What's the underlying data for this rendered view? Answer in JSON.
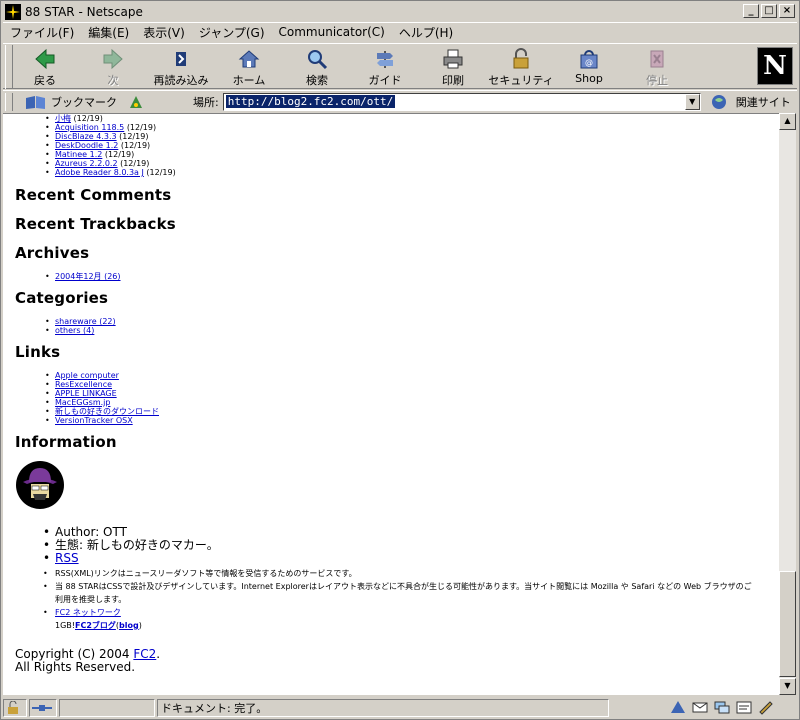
{
  "window": {
    "title": "88 STAR - Netscape"
  },
  "menu": [
    "ファイル(F)",
    "編集(E)",
    "表示(V)",
    "ジャンプ(G)",
    "Communicator(C)",
    "ヘルプ(H)"
  ],
  "toolbar": {
    "back": "戻る",
    "forward": "次",
    "reload": "再読み込み",
    "home": "ホーム",
    "search": "検索",
    "guide": "ガイド",
    "print": "印刷",
    "security": "セキュリティ",
    "shop": "Shop",
    "stop": "停止",
    "logo": "N"
  },
  "location": {
    "bookmarks_label": "ブックマーク",
    "location_label": "場所:",
    "url": "http://blog2.fc2.com/ott/",
    "related_label": "関連サイト"
  },
  "page": {
    "recent_entries": [
      {
        "title": "小梅",
        "date": "(12/19)"
      },
      {
        "title": "Acquisition 118.5",
        "date": "(12/19)"
      },
      {
        "title": "DiscBlaze 4.3.3",
        "date": "(12/19)"
      },
      {
        "title": "DeskDoodle 1.2",
        "date": "(12/19)"
      },
      {
        "title": "Matinee 1.2",
        "date": "(12/19)"
      },
      {
        "title": "Azureus 2.2.0.2",
        "date": "(12/19)"
      },
      {
        "title": "Adobe Reader 8.0.3a J",
        "date": "(12/19)"
      }
    ],
    "recent_comments_heading": "Recent Comments",
    "recent_trackbacks_heading": "Recent Trackbacks",
    "archives_heading": "Archives",
    "archives": [
      "2004年12月 (26)"
    ],
    "categories_heading": "Categories",
    "categories": [
      "shareware (22)",
      "others (4)"
    ],
    "links_heading": "Links",
    "links": [
      "Apple computer",
      "ResExcellence",
      "APPLE LINKAGE",
      "MacEGGsm.jp",
      "新しもの好きのダウンロード",
      "VersionTracker OSX"
    ],
    "information_heading": "Information",
    "info": {
      "author": "Author: OTT",
      "about": "生態: 新しもの好きのマカー。",
      "rss_link": "RSS",
      "rss_desc": "RSS(XML)リンクはニュースリーダソフト等で情報を受信するためのサービスです。",
      "css_note_1": "当 88 STARはCSSで設計及びデザインしています。Internet Explorerはレイアウト表示などに不具合が生じる可能性があります。当サイト閲覧には Mozilla や Safari などの Web ブラウザのご",
      "css_note_2": "利用を推奨します。",
      "fc2_network": "FC2 ネットワーク",
      "fc2_sub_prefix": "1GB!",
      "fc2_blog": "FC2ブログ",
      "fc2_blog_paren_open": "(",
      "fc2_blog_en": "blog",
      "fc2_blog_paren_close": ")"
    },
    "copyright_prefix": "Copyright (C) 2004 ",
    "copyright_link": "FC2",
    "copyright_suffix": ".",
    "rights": "All Rights Reserved."
  },
  "status": {
    "text": "ドキュメント: 完了。"
  }
}
